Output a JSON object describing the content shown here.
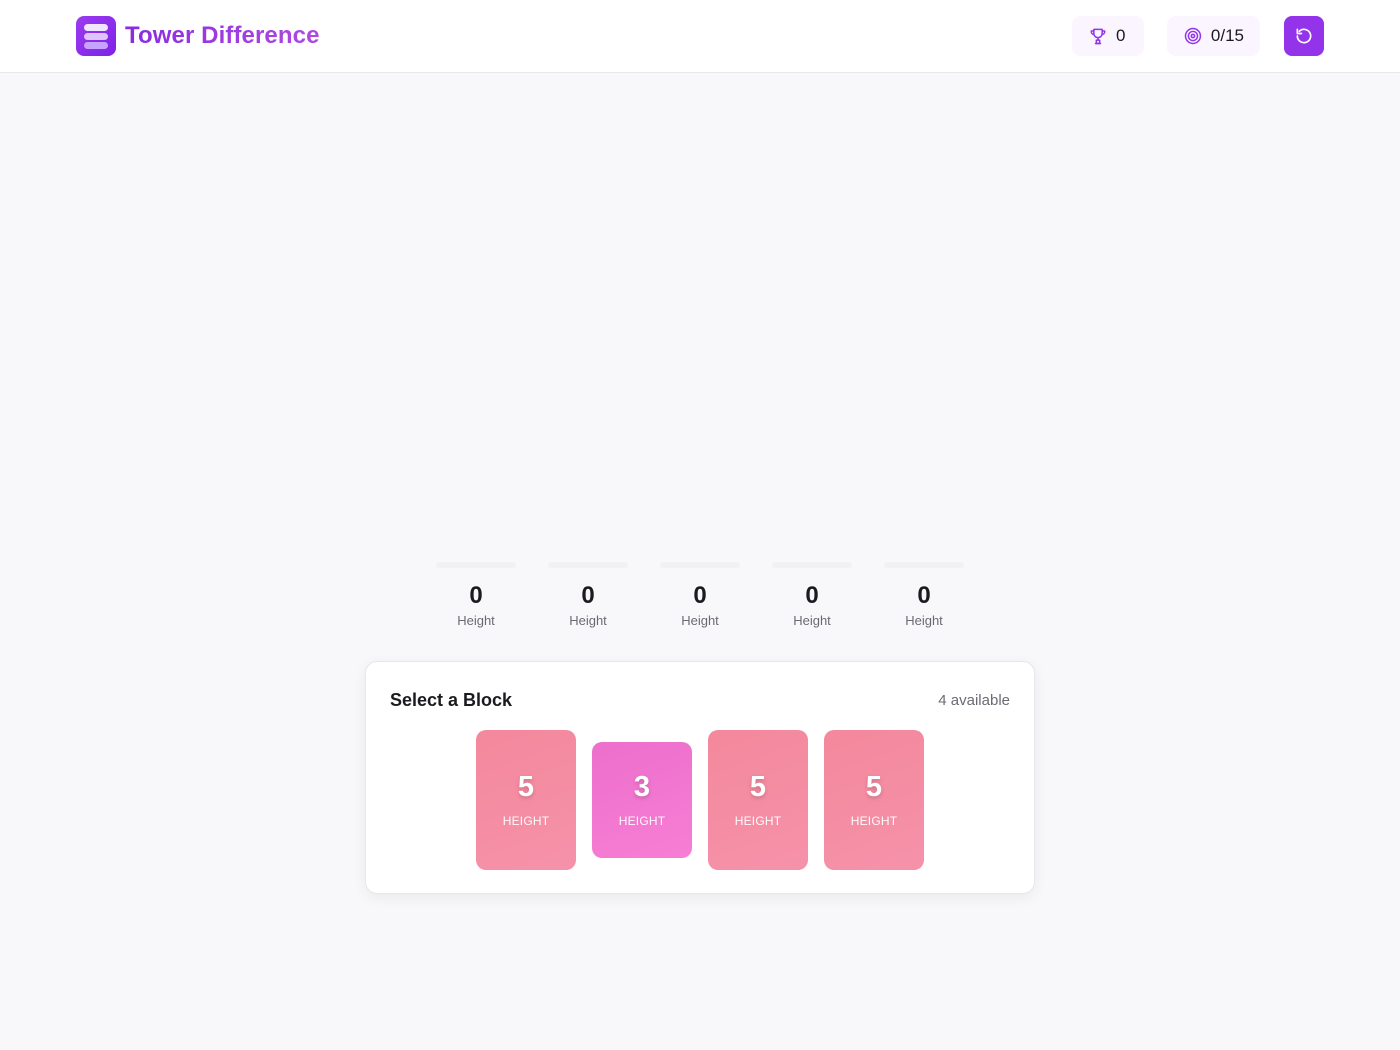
{
  "header": {
    "title": "Tower Difference",
    "score": "0",
    "progress": "0/15",
    "accent": "#9333ea"
  },
  "icons": {
    "logo": "stacked-blocks-icon",
    "score": "trophy-icon",
    "progress": "target-icon",
    "reset": "reset-icon"
  },
  "towers": [
    {
      "value": "0",
      "label": "Height"
    },
    {
      "value": "0",
      "label": "Height"
    },
    {
      "value": "0",
      "label": "Height"
    },
    {
      "value": "0",
      "label": "Height"
    },
    {
      "value": "0",
      "label": "Height"
    }
  ],
  "selector": {
    "title": "Select a Block",
    "available": "4 available",
    "blocks": [
      {
        "value": "5",
        "label": "HEIGHT",
        "color": "#f4889c"
      },
      {
        "value": "3",
        "label": "HEIGHT",
        "color": "#ec6fcc"
      },
      {
        "value": "5",
        "label": "HEIGHT",
        "color": "#f4889c"
      },
      {
        "value": "5",
        "label": "HEIGHT",
        "color": "#f4889c"
      }
    ]
  }
}
